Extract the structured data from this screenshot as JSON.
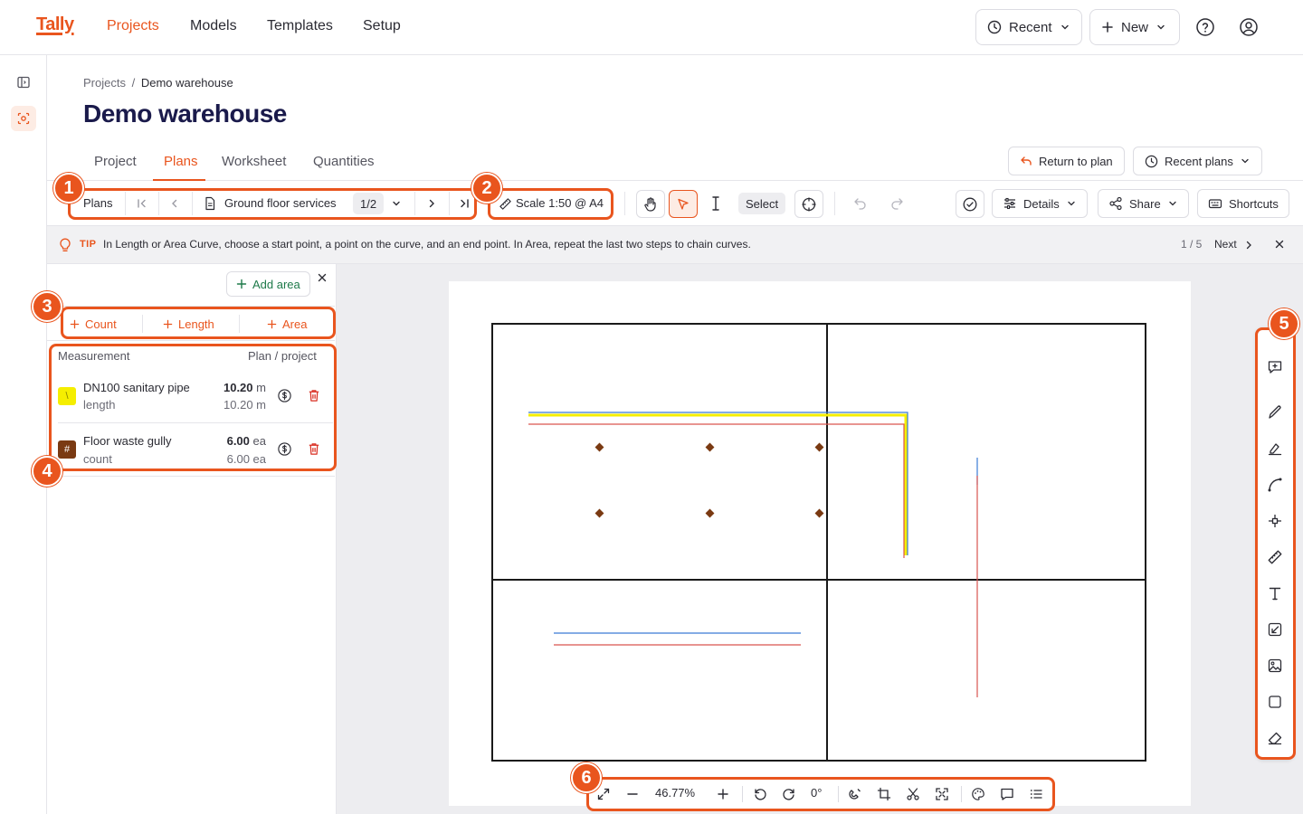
{
  "app": {
    "logo": "Tally"
  },
  "topnav": {
    "items": [
      {
        "label": "Projects",
        "active": true
      },
      {
        "label": "Models"
      },
      {
        "label": "Templates"
      },
      {
        "label": "Setup"
      }
    ],
    "recent_label": "Recent",
    "new_label": "New",
    "help_icon": "help-circle-icon",
    "account_icon": "user-circle-icon"
  },
  "breadcrumb": {
    "root": "Projects",
    "sep": "/",
    "current": "Demo warehouse"
  },
  "page": {
    "title": "Demo warehouse"
  },
  "tabs": [
    {
      "label": "Project"
    },
    {
      "label": "Plans",
      "active": true
    },
    {
      "label": "Worksheet"
    },
    {
      "label": "Quantities"
    }
  ],
  "header_actions": {
    "return_label": "Return to plan",
    "recent_plans_label": "Recent plans"
  },
  "toolbar": {
    "plans_label": "Plans",
    "plan_name": "Ground floor services",
    "plan_page": "1/2",
    "scale_label": "Scale 1:50 @ A4",
    "select_label": "Select",
    "details_label": "Details",
    "share_label": "Share",
    "shortcuts_label": "Shortcuts"
  },
  "tip": {
    "label": "TIP",
    "text": "In Length or Area Curve, choose a start point, a point on the curve, and an end point. In Area, repeat the last two steps to chain curves.",
    "counter": "1 / 5",
    "next_label": "Next"
  },
  "measure_panel": {
    "add_area_label": "Add area",
    "tabs": [
      {
        "label": "Count"
      },
      {
        "label": "Length"
      },
      {
        "label": "Area"
      }
    ],
    "col_measurement": "Measurement",
    "col_plan_project": "Plan / project",
    "rows": [
      {
        "name": "DN100 sanitary pipe",
        "type": "length",
        "plan_value": "10.20",
        "plan_unit": "m",
        "project_value": "10.20 m",
        "color": "#f5ee00",
        "symbol": "\\"
      },
      {
        "name": "Floor waste gully",
        "type": "count",
        "plan_value": "6.00",
        "plan_unit": "ea",
        "project_value": "6.00 ea",
        "color": "#7a3a12",
        "symbol": "#"
      }
    ]
  },
  "bottom_controls": {
    "zoom": "46.77%",
    "rotation": "0°"
  },
  "callouts": [
    "1",
    "2",
    "3",
    "4",
    "5",
    "6"
  ],
  "colors": {
    "accent": "#e9551e",
    "title": "#1a1a4b",
    "pipe_yellow": "#f5ee00",
    "pipe_red": "#d9534f",
    "pipe_blue": "#3a7bd5",
    "gully_brown": "#7a3a12"
  }
}
